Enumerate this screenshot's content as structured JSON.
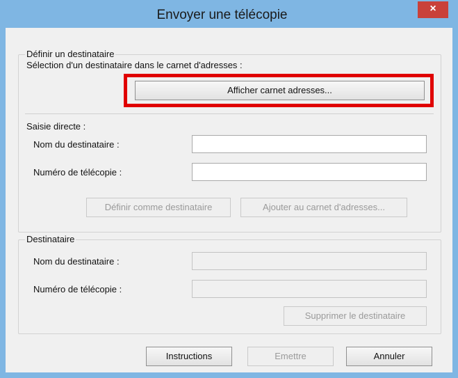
{
  "window": {
    "title": "Envoyer une télécopie",
    "close_glyph": "×"
  },
  "define_group": {
    "legend": "Définir un destinataire",
    "address_book_label": "Sélection d'un destinataire dans le carnet d'adresses :",
    "show_address_book_button": "Afficher carnet adresses...",
    "highlight_color": "#e00000"
  },
  "direct_entry": {
    "heading": "Saisie directe :",
    "name_label": "Nom du destinataire :",
    "name_value": "",
    "fax_label": "Numéro de télécopie :",
    "fax_value": "",
    "set_recipient_button": "Définir comme destinataire",
    "add_to_book_button": "Ajouter au carnet d'adresses..."
  },
  "recipient_group": {
    "legend": "Destinataire",
    "name_label": "Nom du destinataire :",
    "name_value": "",
    "fax_label": "Numéro de télécopie :",
    "fax_value": "",
    "delete_button": "Supprimer le destinataire"
  },
  "footer": {
    "instructions_button": "Instructions",
    "send_button": "Emettre",
    "cancel_button": "Annuler"
  }
}
